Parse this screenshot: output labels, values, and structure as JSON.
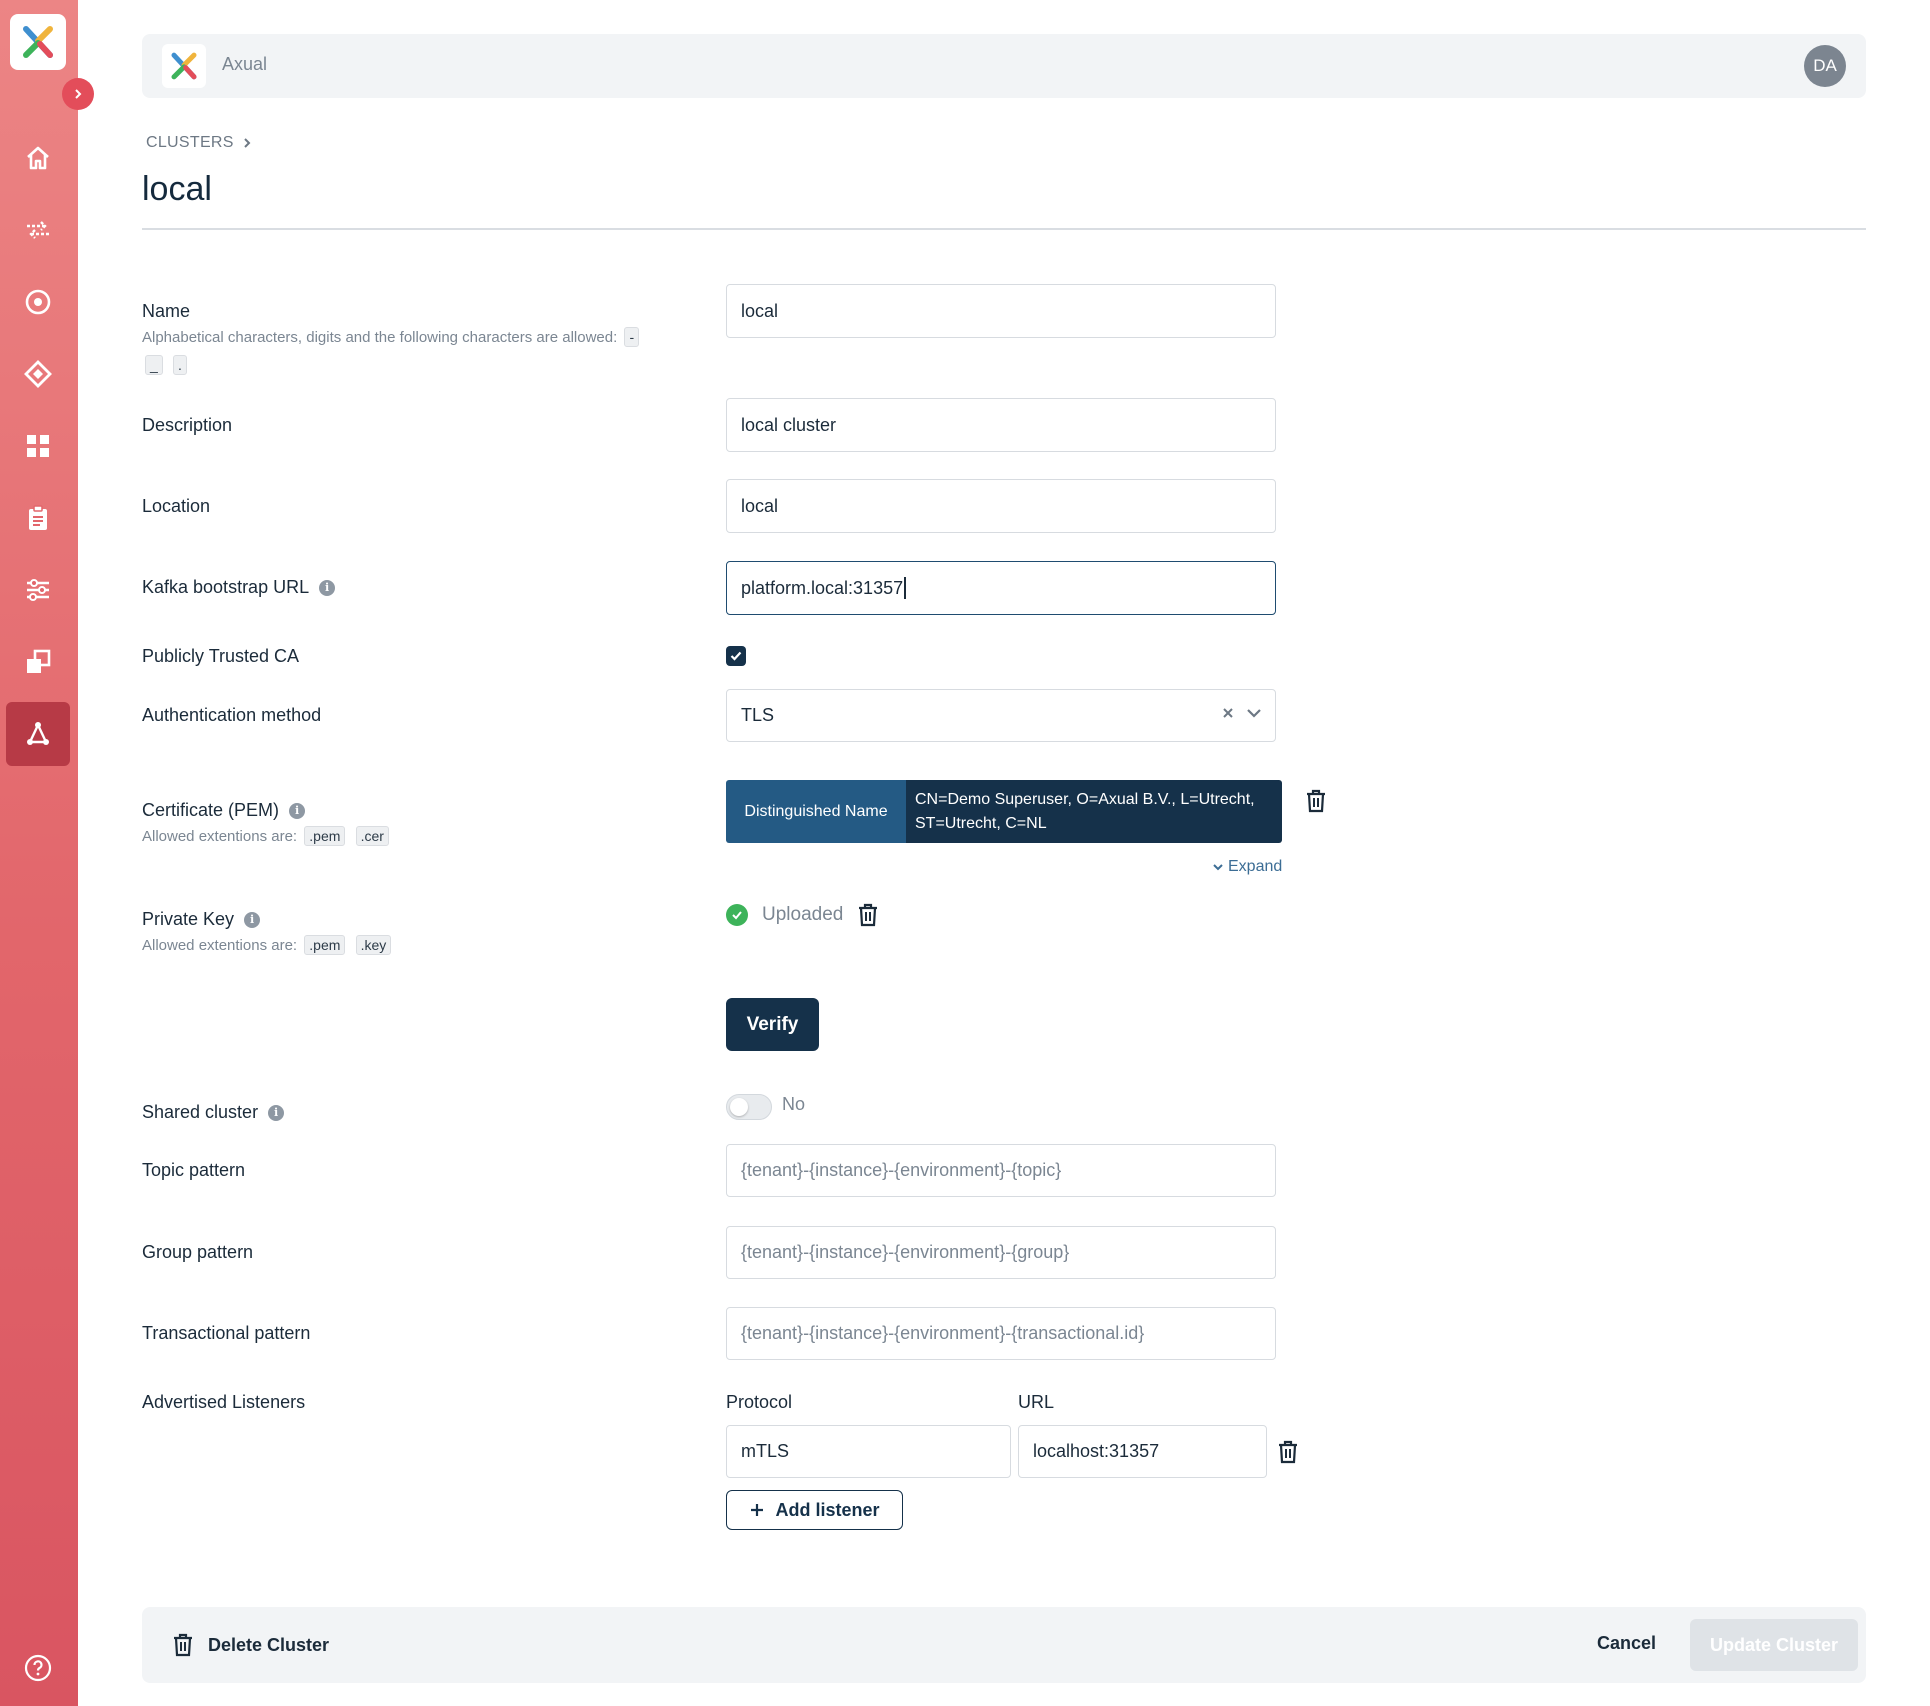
{
  "app": {
    "name": "Axual",
    "user_initials": "DA"
  },
  "colors": {
    "accent": "#e34d5a",
    "primary": "#15314a",
    "success": "#3db35a"
  },
  "sidebar": {
    "items": [
      {
        "icon": "home-icon"
      },
      {
        "icon": "streams-icon"
      },
      {
        "icon": "target-icon"
      },
      {
        "icon": "diamond-icon"
      },
      {
        "icon": "dashboard-icon"
      },
      {
        "icon": "clipboard-icon"
      },
      {
        "icon": "sliders-icon"
      },
      {
        "icon": "copy-icon"
      },
      {
        "icon": "clusters-icon",
        "active": true
      },
      {
        "icon": "help-icon"
      }
    ]
  },
  "breadcrumb": {
    "root": "CLUSTERS"
  },
  "page": {
    "title": "local"
  },
  "form": {
    "name": {
      "label": "Name",
      "hint": "Alphabetical characters, digits and the following characters are allowed:",
      "allowed_chars": [
        "-",
        "_",
        "."
      ],
      "value": "local"
    },
    "description": {
      "label": "Description",
      "value": "local cluster"
    },
    "location": {
      "label": "Location",
      "value": "local"
    },
    "bootstrap": {
      "label": "Kafka bootstrap URL",
      "value": "platform.local:31357"
    },
    "trusted_ca": {
      "label": "Publicly Trusted CA",
      "checked": true
    },
    "auth": {
      "label": "Authentication method",
      "value": "TLS"
    },
    "certificate": {
      "label": "Certificate (PEM)",
      "hint": "Allowed extentions are:",
      "extensions": [
        ".pem",
        ".cer"
      ],
      "dn_key": "Distinguished Name",
      "dn_value": "CN=Demo Superuser, O=Axual B.V., L=Utrecht, ST=Utrecht, C=NL",
      "expand": "Expand"
    },
    "private_key": {
      "label": "Private Key",
      "hint": "Allowed extentions are:",
      "extensions": [
        ".pem",
        ".key"
      ],
      "status": "Uploaded"
    },
    "verify_label": "Verify",
    "shared": {
      "label": "Shared cluster",
      "state": "No"
    },
    "topic_pattern": {
      "label": "Topic pattern",
      "placeholder": "{tenant}-{instance}-{environment}-{topic}"
    },
    "group_pattern": {
      "label": "Group pattern",
      "placeholder": "{tenant}-{instance}-{environment}-{group}"
    },
    "transactional_pattern": {
      "label": "Transactional pattern",
      "placeholder": "{tenant}-{instance}-{environment}-{transactional.id}"
    },
    "listeners": {
      "label": "Advertised Listeners",
      "protocol_header": "Protocol",
      "url_header": "URL",
      "rows": [
        {
          "protocol": "mTLS",
          "url": "localhost:31357"
        }
      ],
      "add_label": "Add listener"
    }
  },
  "footer": {
    "delete_label": "Delete Cluster",
    "cancel_label": "Cancel",
    "update_label": "Update Cluster"
  }
}
